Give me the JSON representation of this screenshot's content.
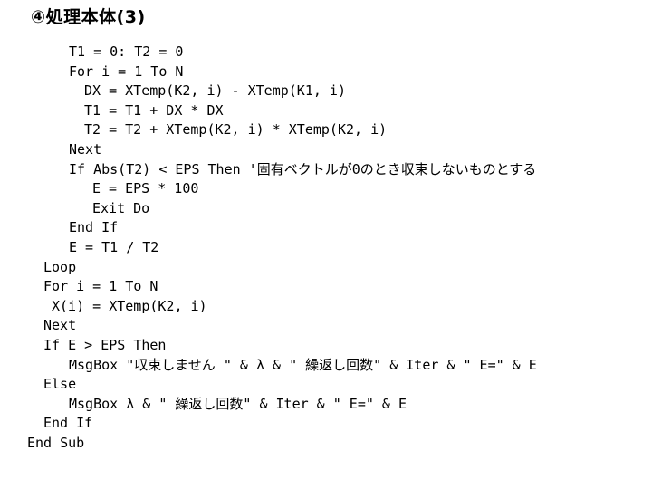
{
  "title": "④処理本体(3)",
  "code_lines": [
    {
      "indent": 76,
      "text": "T1 = 0: T2 = 0"
    },
    {
      "indent": 76,
      "text": "For i = 1 To N"
    },
    {
      "indent": 93,
      "text": "DX = XTemp(K2, i) - XTemp(K1, i)"
    },
    {
      "indent": 93,
      "text": "T1 = T1 + DX * DX"
    },
    {
      "indent": 93,
      "text": "T2 = T2 + XTemp(K2, i) * XTemp(K2, i)"
    },
    {
      "indent": 76,
      "text": "Next"
    },
    {
      "indent": 76,
      "text": "If Abs(T2) < EPS Then '固有ベクトルが0のとき収束しないものとする"
    },
    {
      "indent": 102,
      "text": "E = EPS * 100"
    },
    {
      "indent": 102,
      "text": "Exit Do"
    },
    {
      "indent": 76,
      "text": "End If"
    },
    {
      "indent": 76,
      "text": "E = T1 / T2"
    },
    {
      "indent": 48,
      "text": "Loop"
    },
    {
      "indent": 48,
      "text": "For i = 1 To N"
    },
    {
      "indent": 57,
      "text": "X(i) = XTemp(K2, i)"
    },
    {
      "indent": 48,
      "text": "Next"
    },
    {
      "indent": 48,
      "text": "If E > EPS Then"
    },
    {
      "indent": 76,
      "text": "MsgBox \"収束しません \" & λ & \" 繰返し回数\" & Iter & \" E=\" & E"
    },
    {
      "indent": 48,
      "text": "Else"
    },
    {
      "indent": 76,
      "text": "MsgBox λ & \" 繰返し回数\" & Iter & \" E=\" & E"
    },
    {
      "indent": 48,
      "text": "End If"
    },
    {
      "indent": 30,
      "text": "End Sub"
    }
  ]
}
